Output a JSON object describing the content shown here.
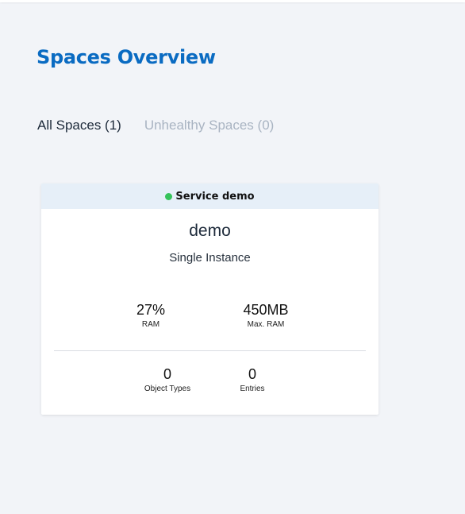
{
  "page": {
    "title": "Spaces Overview"
  },
  "tabs": [
    {
      "label": "All Spaces (1)",
      "active": true
    },
    {
      "label": "Unhealthy Spaces (0)",
      "active": false
    }
  ],
  "space_card": {
    "header": "Service demo",
    "status_color": "#35c35b",
    "name": "demo",
    "type": "Single Instance",
    "ram_value": "27%",
    "ram_label": "RAM",
    "max_ram_value": "450MB",
    "max_ram_label": "Max. RAM",
    "object_types_value": "0",
    "object_types_label": "Object Types",
    "entries_value": "0",
    "entries_label": "Entries"
  },
  "colors": {
    "title": "#0a6bc2",
    "background": "#f2f4f8",
    "card_header_bg": "#e6eff8",
    "tab_inactive": "#a9b4c2"
  }
}
